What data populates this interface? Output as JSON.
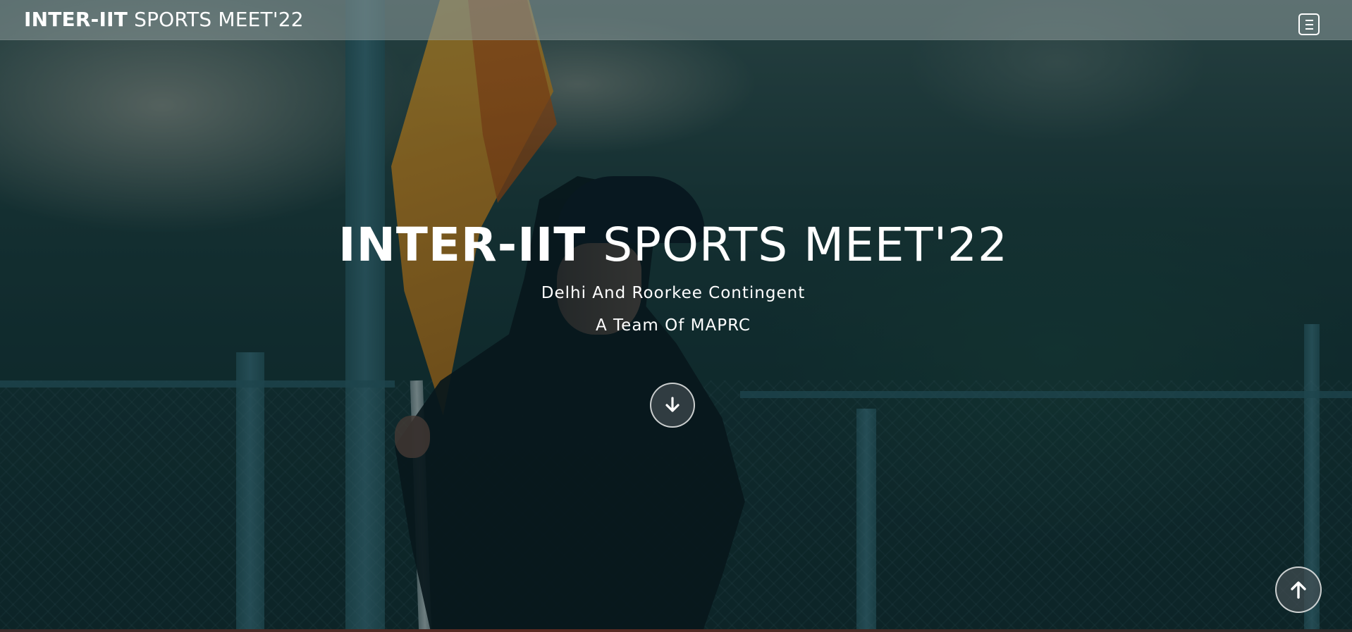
{
  "navbar": {
    "brand_bold": "INTER-IIT",
    "brand_light": "SPORTS MEET'22",
    "menu_icon": "hamburger-menu-icon"
  },
  "hero": {
    "title_bold": "INTER-IIT",
    "title_light": "SPORTS MEET'22",
    "subtitle": "Delhi And Roorkee Contingent",
    "tagline": "A Team Of MAPRC",
    "scroll_down_icon": "arrow-down-icon",
    "background": "video-frame-flag-bearer"
  },
  "floating": {
    "back_to_top_icon": "arrow-up-icon"
  },
  "colors": {
    "text": "#ffffff",
    "navbar_bg": "#8c9b9b",
    "overlay": "#061e22"
  }
}
